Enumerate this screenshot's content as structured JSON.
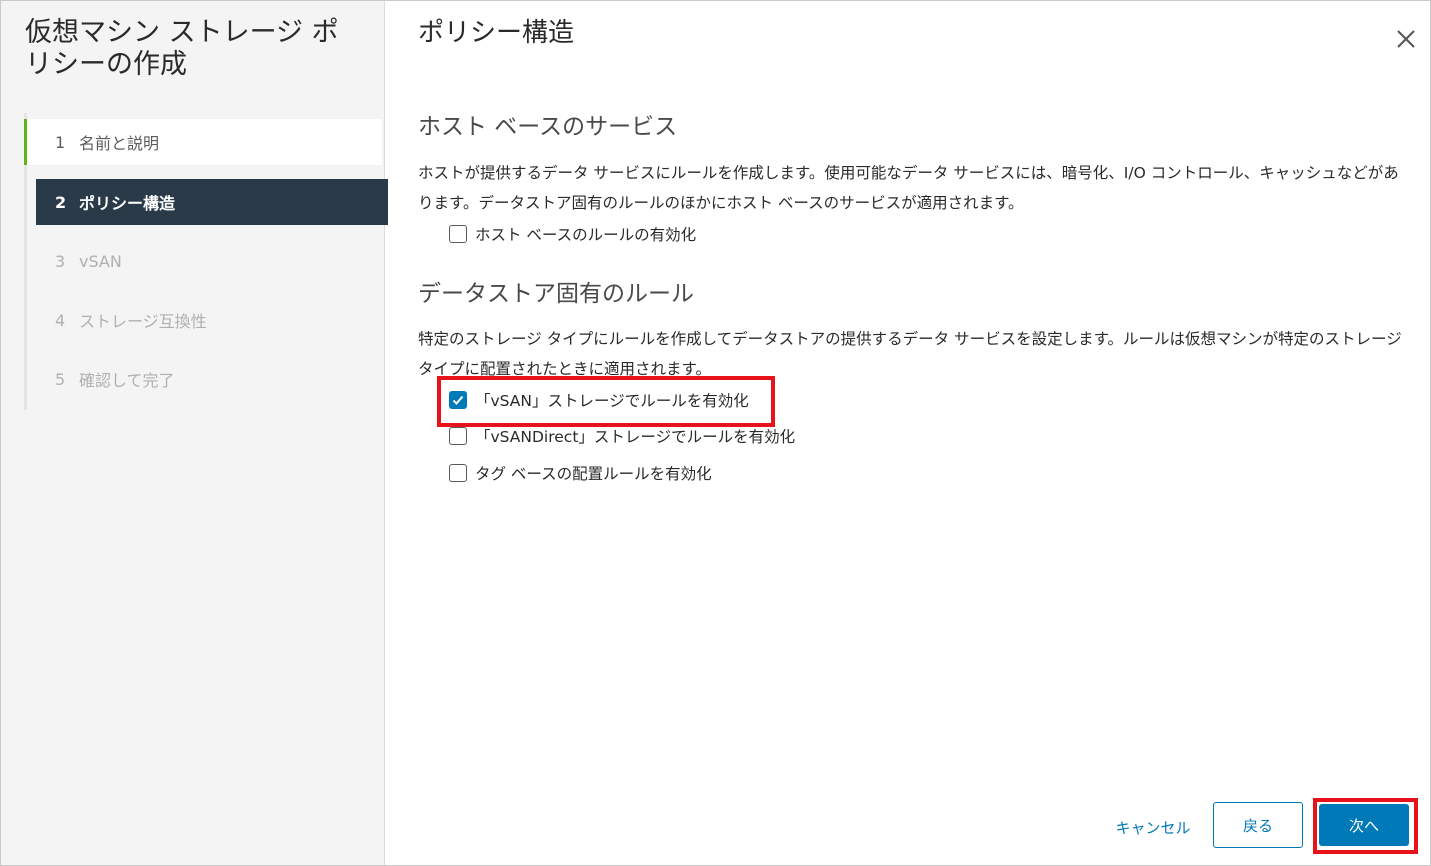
{
  "sidebar": {
    "title": "仮想マシン ストレージ ポリシーの作成",
    "steps": [
      {
        "num": "1",
        "label": "名前と説明",
        "state": "done"
      },
      {
        "num": "2",
        "label": "ポリシー構造",
        "state": "active"
      },
      {
        "num": "3",
        "label": "vSAN",
        "state": "disabled"
      },
      {
        "num": "4",
        "label": "ストレージ互換性",
        "state": "disabled"
      },
      {
        "num": "5",
        "label": "確認して完了",
        "state": "disabled"
      }
    ]
  },
  "main": {
    "title": "ポリシー構造",
    "close_icon": "close-icon",
    "host_section": {
      "title": "ホスト ベースのサービス",
      "description": "ホストが提供するデータ サービスにルールを作成します。使用可能なデータ サービスには、暗号化、I/O コントロール、キャッシュなどがあります。データストア固有のルールのほかにホスト ベースのサービスが適用されます。",
      "checkbox": {
        "label": "ホスト ベースのルールの有効化",
        "checked": false
      }
    },
    "datastore_section": {
      "title": "データストア固有のルール",
      "description": "特定のストレージ タイプにルールを作成してデータストアの提供するデータ サービスを設定します。ルールは仮想マシンが特定のストレージ タイプに配置されたときに適用されます。",
      "checkboxes": [
        {
          "label": "「vSAN」ストレージでルールを有効化",
          "checked": true
        },
        {
          "label": "「vSANDirect」ストレージでルールを有効化",
          "checked": false
        },
        {
          "label": "タグ ベースの配置ルールを有効化",
          "checked": false
        }
      ]
    }
  },
  "footer": {
    "cancel_label": "キャンセル",
    "back_label": "戻る",
    "next_label": "次へ"
  },
  "colors": {
    "accent": "#0079b8",
    "active_step_bg": "#2b3a48",
    "done_step_bar": "#60b515",
    "highlight": "#e8121b"
  }
}
